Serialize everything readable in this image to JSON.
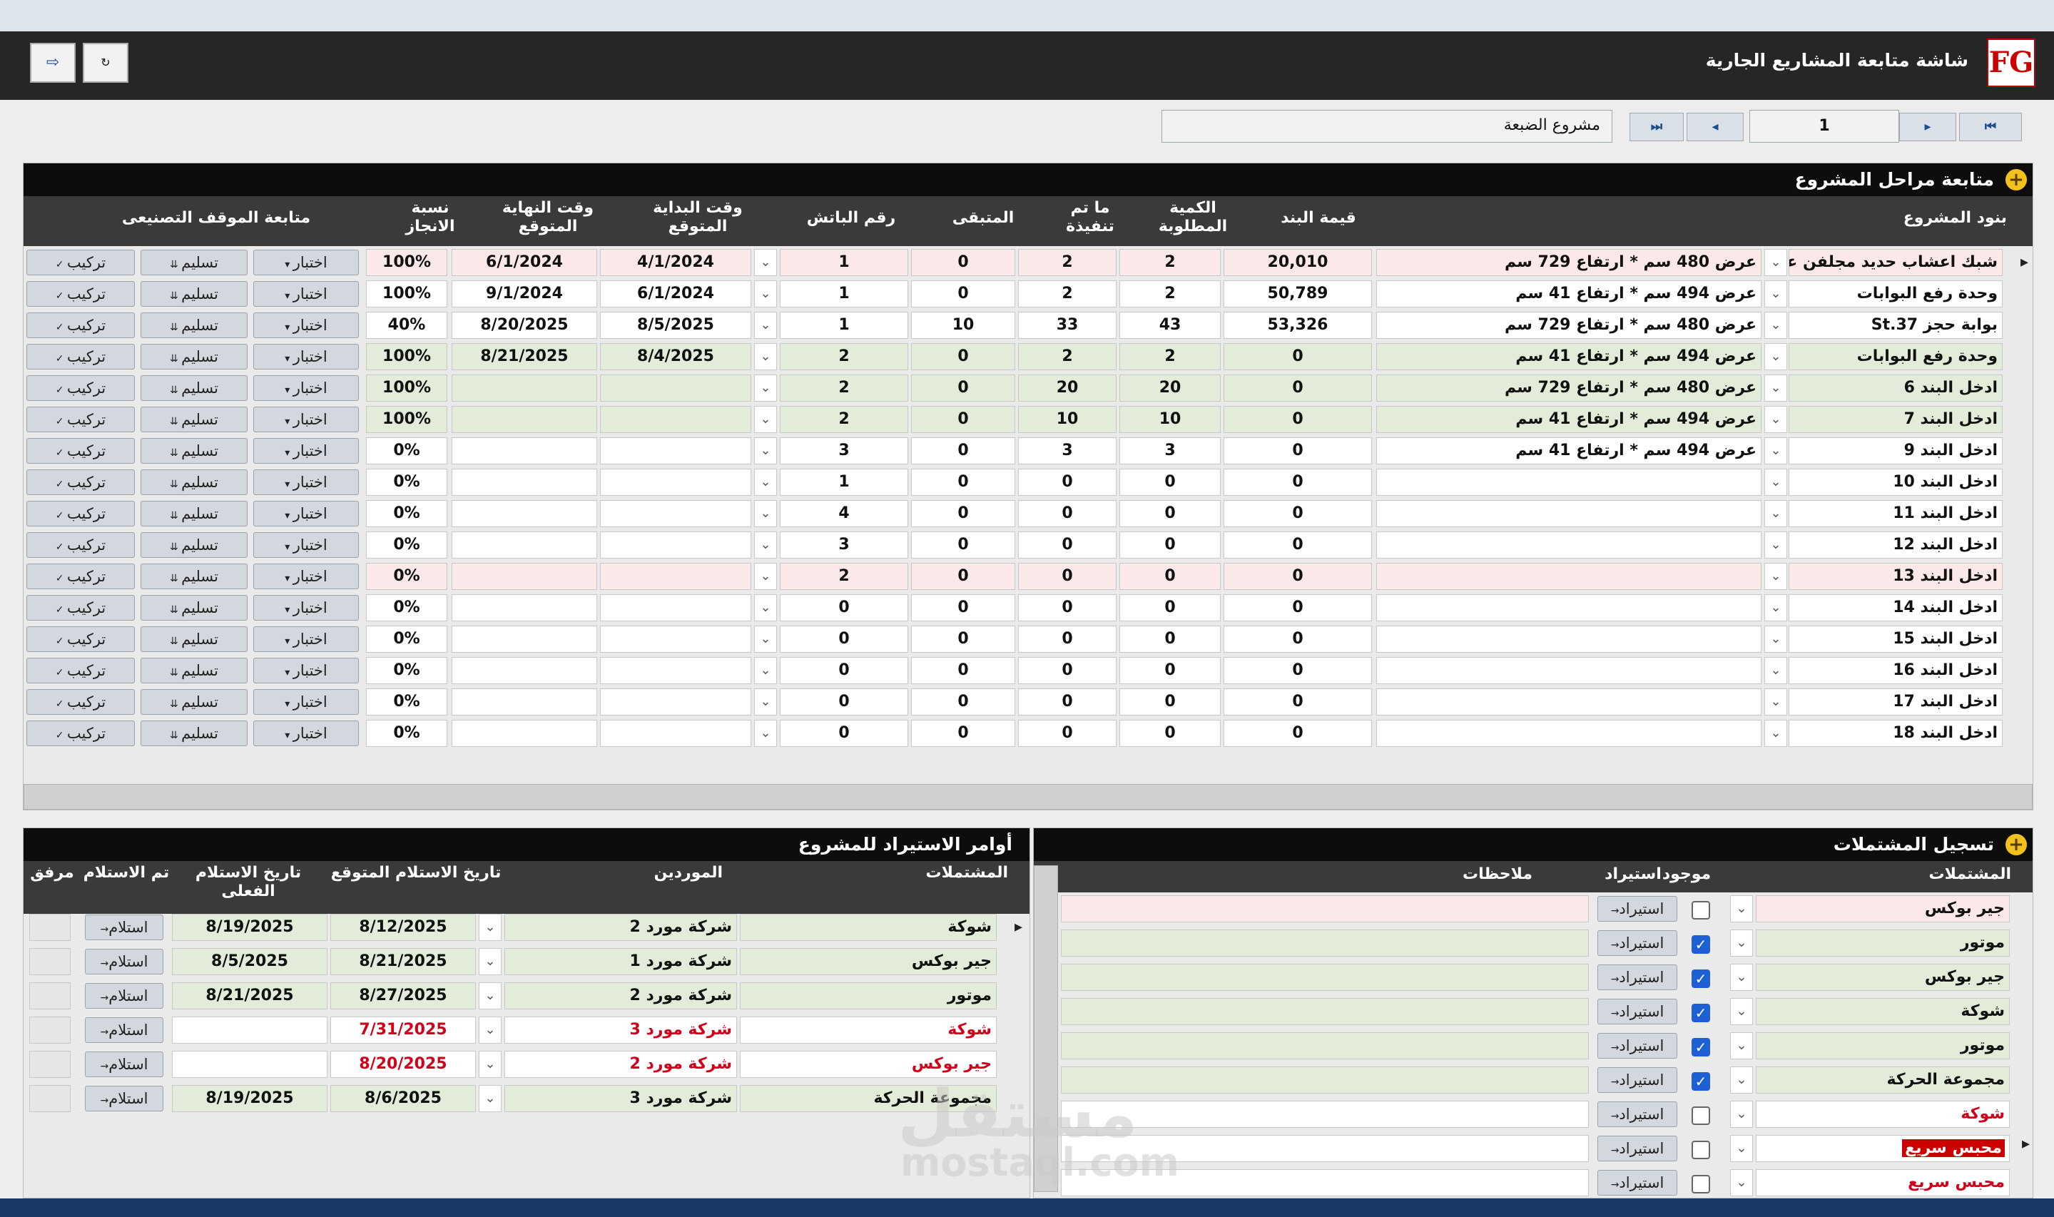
{
  "app": {
    "title": "شاشة متابعة المشاريع الجارية",
    "logo_text": "FG",
    "nav_first": "⏮",
    "nav_prev": "◂",
    "nav_next": "▸",
    "nav_last": "⏭",
    "page_number": "1",
    "project_name": "مشروع الضبعة"
  },
  "stages": {
    "title": "متابعة مراحل المشروع",
    "headers": {
      "item": "بنود المشروع",
      "value": "قيمة البند",
      "qty": "الكمية المطلوبة",
      "done": "ما تم تنفيذة",
      "remain": "المتبقى",
      "batch": "رقم الباتش",
      "start": "وقت البداية المتوقع",
      "end": "وقت النهاية المتوقع",
      "pct": "نسبة الانجاز",
      "factory": "متابعة الموقف التصنيعى"
    },
    "btn_test": "اختبار",
    "btn_deliver": "تسليم",
    "btn_install": "تركيب",
    "rows": [
      {
        "name": "شبك اعشاب حديد مجلفن عالساخن",
        "spec": "عرض 480 سم * ارتفاع 729 سم",
        "value": "20,010",
        "qty": "2",
        "done": "2",
        "remain": "0",
        "batch": "1",
        "start": "4/1/2024",
        "end": "6/1/2024",
        "pct": "100%",
        "style": "pink"
      },
      {
        "name": "وحدة رفع البوابات",
        "spec": "عرض 494 سم * ارتفاع 41 سم",
        "value": "50,789",
        "qty": "2",
        "done": "2",
        "remain": "0",
        "batch": "1",
        "start": "6/1/2024",
        "end": "9/1/2024",
        "pct": "100%",
        "style": "white"
      },
      {
        "name": "بوابة حجز St.37",
        "spec": "عرض 480 سم * ارتفاع 729 سم",
        "value": "53,326",
        "qty": "43",
        "done": "33",
        "remain": "10",
        "batch": "1",
        "start": "8/5/2025",
        "end": "8/20/2025",
        "pct": "40%",
        "style": "white"
      },
      {
        "name": "وحدة رفع البوابات",
        "spec": "عرض 494 سم * ارتفاع 41 سم",
        "value": "0",
        "qty": "2",
        "done": "2",
        "remain": "0",
        "batch": "2",
        "start": "8/4/2025",
        "end": "8/21/2025",
        "pct": "100%",
        "style": "green"
      },
      {
        "name": "ادخل البند 6",
        "spec": "عرض 480 سم * ارتفاع 729 سم",
        "value": "0",
        "qty": "20",
        "done": "20",
        "remain": "0",
        "batch": "2",
        "start": "",
        "end": "",
        "pct": "100%",
        "style": "green"
      },
      {
        "name": "ادخل البند 7",
        "spec": "عرض 494 سم * ارتفاع 41 سم",
        "value": "0",
        "qty": "10",
        "done": "10",
        "remain": "0",
        "batch": "2",
        "start": "",
        "end": "",
        "pct": "100%",
        "style": "green"
      },
      {
        "name": "ادخل البند 9",
        "spec": "عرض 494 سم * ارتفاع 41 سم",
        "value": "0",
        "qty": "3",
        "done": "3",
        "remain": "0",
        "batch": "3",
        "start": "",
        "end": "",
        "pct": "0%",
        "style": "white"
      },
      {
        "name": "ادخل البند 10",
        "spec": "",
        "value": "0",
        "qty": "0",
        "done": "0",
        "remain": "0",
        "batch": "1",
        "start": "",
        "end": "",
        "pct": "0%",
        "style": "white"
      },
      {
        "name": "ادخل البند 11",
        "spec": "",
        "value": "0",
        "qty": "0",
        "done": "0",
        "remain": "0",
        "batch": "4",
        "start": "",
        "end": "",
        "pct": "0%",
        "style": "white"
      },
      {
        "name": "ادخل البند 12",
        "spec": "",
        "value": "0",
        "qty": "0",
        "done": "0",
        "remain": "0",
        "batch": "3",
        "start": "",
        "end": "",
        "pct": "0%",
        "style": "white"
      },
      {
        "name": "ادخل البند 13",
        "spec": "",
        "value": "0",
        "qty": "0",
        "done": "0",
        "remain": "0",
        "batch": "2",
        "start": "",
        "end": "",
        "pct": "0%",
        "style": "pink"
      },
      {
        "name": "ادخل البند 14",
        "spec": "",
        "value": "0",
        "qty": "0",
        "done": "0",
        "remain": "0",
        "batch": "0",
        "start": "",
        "end": "",
        "pct": "0%",
        "style": "white"
      },
      {
        "name": "ادخل البند 15",
        "spec": "",
        "value": "0",
        "qty": "0",
        "done": "0",
        "remain": "0",
        "batch": "0",
        "start": "",
        "end": "",
        "pct": "0%",
        "style": "white"
      },
      {
        "name": "ادخل البند 16",
        "spec": "",
        "value": "0",
        "qty": "0",
        "done": "0",
        "remain": "0",
        "batch": "0",
        "start": "",
        "end": "",
        "pct": "0%",
        "style": "white"
      },
      {
        "name": "ادخل البند 17",
        "spec": "",
        "value": "0",
        "qty": "0",
        "done": "0",
        "remain": "0",
        "batch": "0",
        "start": "",
        "end": "",
        "pct": "0%",
        "style": "white"
      },
      {
        "name": "ادخل البند 18",
        "spec": "",
        "value": "0",
        "qty": "0",
        "done": "0",
        "remain": "0",
        "batch": "0",
        "start": "",
        "end": "",
        "pct": "0%",
        "style": "white"
      }
    ]
  },
  "imports": {
    "title": "أوامر الاستيراد للمشروع",
    "headers": {
      "component": "المشتملات",
      "supplier": "الموردين",
      "expected": "تاريخ الاستلام المتوقع",
      "actual": "تاريخ الاستلام الفعلى",
      "received": "تم الاستلام",
      "attach": "مرفق"
    },
    "btn_receive": "استلام",
    "rows": [
      {
        "component": "شوكة",
        "supplier": "شركة مورد 2",
        "expected": "8/12/2025",
        "actual": "8/19/2025",
        "style": "green",
        "red": false
      },
      {
        "component": "جير بوكس",
        "supplier": "شركة مورد 1",
        "expected": "8/21/2025",
        "actual": "8/5/2025",
        "style": "green",
        "red": false
      },
      {
        "component": "موتور",
        "supplier": "شركة مورد 2",
        "expected": "8/27/2025",
        "actual": "8/21/2025",
        "style": "green",
        "red": false
      },
      {
        "component": "شوكة",
        "supplier": "شركة مورد 3",
        "expected": "7/31/2025",
        "actual": "",
        "style": "white",
        "red": true
      },
      {
        "component": "جير بوكس",
        "supplier": "شركة مورد 2",
        "expected": "8/20/2025",
        "actual": "",
        "style": "white",
        "red": true
      },
      {
        "component": "مجموعة الحركة",
        "supplier": "شركة مورد 3",
        "expected": "8/6/2025",
        "actual": "8/19/2025",
        "style": "green",
        "red": false
      }
    ]
  },
  "components": {
    "title": "تسجيل المشتملات",
    "headers": {
      "component": "المشتملات",
      "exists": "موجود",
      "import": "استيراد",
      "notes": "ملاحظات"
    },
    "btn_import": "استيراد",
    "rows": [
      {
        "component": "جير بوكس",
        "checked": false,
        "style": "pink",
        "red": false
      },
      {
        "component": "موتور",
        "checked": true,
        "style": "green",
        "red": false
      },
      {
        "component": "جير بوكس",
        "checked": true,
        "style": "green",
        "red": false
      },
      {
        "component": "شوكة",
        "checked": true,
        "style": "green",
        "red": false
      },
      {
        "component": "موتور",
        "checked": true,
        "style": "green",
        "red": false
      },
      {
        "component": "مجموعة الحركة",
        "checked": true,
        "style": "green",
        "red": false
      },
      {
        "component": "شوكة",
        "checked": false,
        "style": "white",
        "red": true
      },
      {
        "component": "محبس سريع",
        "checked": false,
        "style": "highlight",
        "red": true
      },
      {
        "component": "محبس سريع",
        "checked": false,
        "style": "white",
        "red": true
      }
    ]
  },
  "watermark": {
    "ar": "مستقل",
    "en": "mostaql.com"
  }
}
